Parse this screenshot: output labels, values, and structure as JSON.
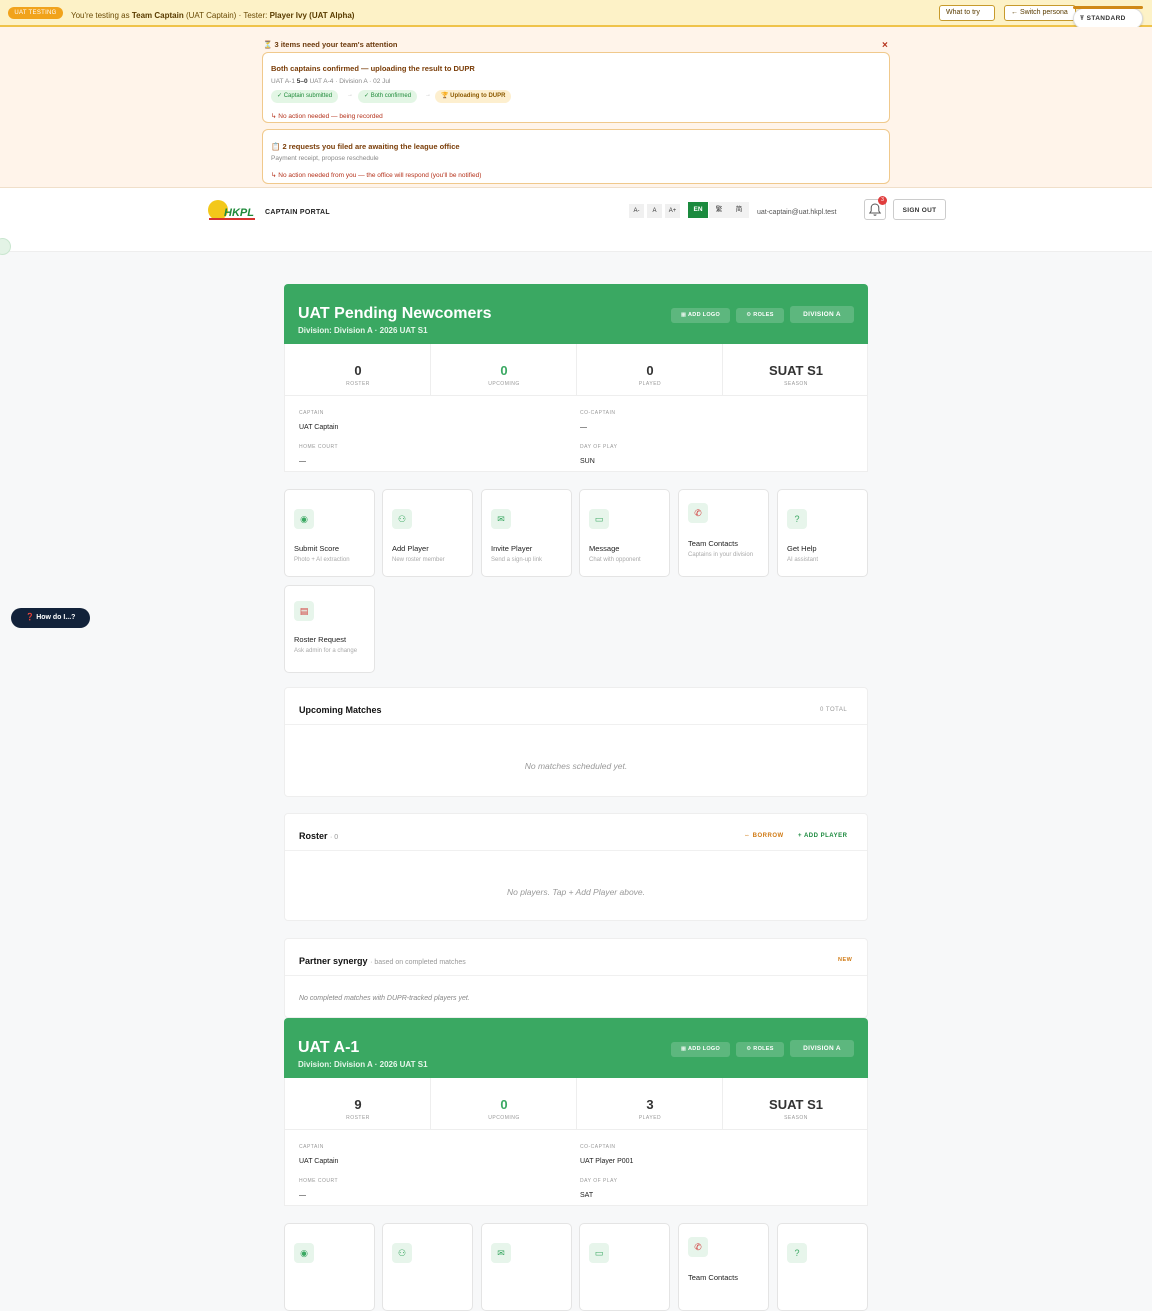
{
  "uat": {
    "pill": "UAT TESTING",
    "prefix": "You're testing as",
    "role": "Team Captain",
    "role_detail": "(UAT Captain)",
    "tester_prefix": "· Tester:",
    "tester": "Player Ivy (UAT Alpha)",
    "what_to_try": "What to try",
    "switch_persona": "← Switch persona",
    "standard": "STANDARD"
  },
  "attention": {
    "title": "3 items need your team's attention",
    "close": "×",
    "card1": {
      "title": "Both captains confirmed — uploading the result to DUPR",
      "match_prefix": "UAT A-1",
      "score": "5–0",
      "match_suffix": "UAT A-4 · Division A · 02 Jul",
      "steps": [
        "✓ Captain submitted",
        "✓ Both confirmed",
        "🏆 Uploading to DUPR"
      ],
      "note": "No action needed — being recorded"
    },
    "card2": {
      "title": "2 requests you filed are awaiting the league office",
      "subtitle": "Payment receipt, propose reschedule",
      "note": "No action needed from you — the office will respond (you'll be notified)"
    }
  },
  "nav": {
    "logo_text": "HKPL",
    "portal": "CAPTAIN PORTAL",
    "font_sizes": [
      "A-",
      "A",
      "A+"
    ],
    "languages": [
      "EN",
      "繁",
      "简"
    ],
    "email": "uat-captain@uat.hkpl.test",
    "badge": "3",
    "sign_out": "SIGN OUT"
  },
  "help": "How do I...?",
  "teams": [
    {
      "name": "UAT Pending Newcomers",
      "division": "Division: Division A · 2026 UAT S1",
      "add_logo": "ADD LOGO",
      "roles": "ROLES",
      "division_btn": "DIVISION A",
      "stats": [
        {
          "value": "0",
          "label": "ROSTER"
        },
        {
          "value": "0",
          "label": "UPCOMING"
        },
        {
          "value": "0",
          "label": "PLAYED"
        },
        {
          "value": "SUAT S1",
          "label": "SEASON"
        }
      ],
      "captain_label": "CAPTAIN",
      "captain": "UAT Captain",
      "cocaptain_label": "CO-CAPTAIN",
      "cocaptain": "—",
      "court_label": "HOME COURT",
      "court": "—",
      "day_label": "DAY OF PLAY",
      "day": "SUN"
    },
    {
      "name": "UAT A-1",
      "division": "Division: Division A · 2026 UAT S1",
      "add_logo": "ADD LOGO",
      "roles": "ROLES",
      "division_btn": "DIVISION A",
      "stats": [
        {
          "value": "9",
          "label": "ROSTER"
        },
        {
          "value": "0",
          "label": "UPCOMING"
        },
        {
          "value": "3",
          "label": "PLAYED"
        },
        {
          "value": "SUAT S1",
          "label": "SEASON"
        }
      ],
      "captain_label": "CAPTAIN",
      "captain": "UAT Captain",
      "cocaptain_label": "CO-CAPTAIN",
      "cocaptain": "UAT Player P001",
      "court_label": "HOME COURT",
      "court": "—",
      "day_label": "DAY OF PLAY",
      "day": "SAT"
    }
  ],
  "tiles": [
    {
      "icon": "camera-icon",
      "title": "Submit Score",
      "sub": "Photo + AI extraction"
    },
    {
      "icon": "add-user-icon",
      "title": "Add Player",
      "sub": "New roster member"
    },
    {
      "icon": "mail-icon",
      "title": "Invite Player",
      "sub": "Send a sign-up link"
    },
    {
      "icon": "chat-icon",
      "title": "Message",
      "sub": "Chat with opponent"
    },
    {
      "icon": "phone-icon",
      "title": "Team Contacts",
      "sub": "Captains in your division"
    },
    {
      "icon": "help-icon",
      "title": "Get Help",
      "sub": "AI assistant"
    },
    {
      "icon": "clipboard-icon",
      "title": "Roster Request",
      "sub": "Ask admin for a change"
    }
  ],
  "tiles_b": [
    {
      "title": "Team Contacts"
    }
  ],
  "upcoming": {
    "title": "Upcoming Matches",
    "count": "0 TOTAL",
    "empty": "No matches scheduled yet."
  },
  "roster": {
    "title": "Roster",
    "count": "· 0",
    "borrow": "⇔ BORROW",
    "add": "+ ADD PLAYER",
    "empty": "No players. Tap + Add Player above."
  },
  "synergy": {
    "title": "Partner synergy",
    "sub": "· based on completed matches",
    "tag": "NEW",
    "empty": "No completed matches with DUPR-tracked players yet."
  },
  "colors": {
    "brand_green": "#3aa862",
    "uat_yellow": "#fdf2c7",
    "attention_bg": "#fff4ea",
    "alert_red": "#b5321b"
  }
}
